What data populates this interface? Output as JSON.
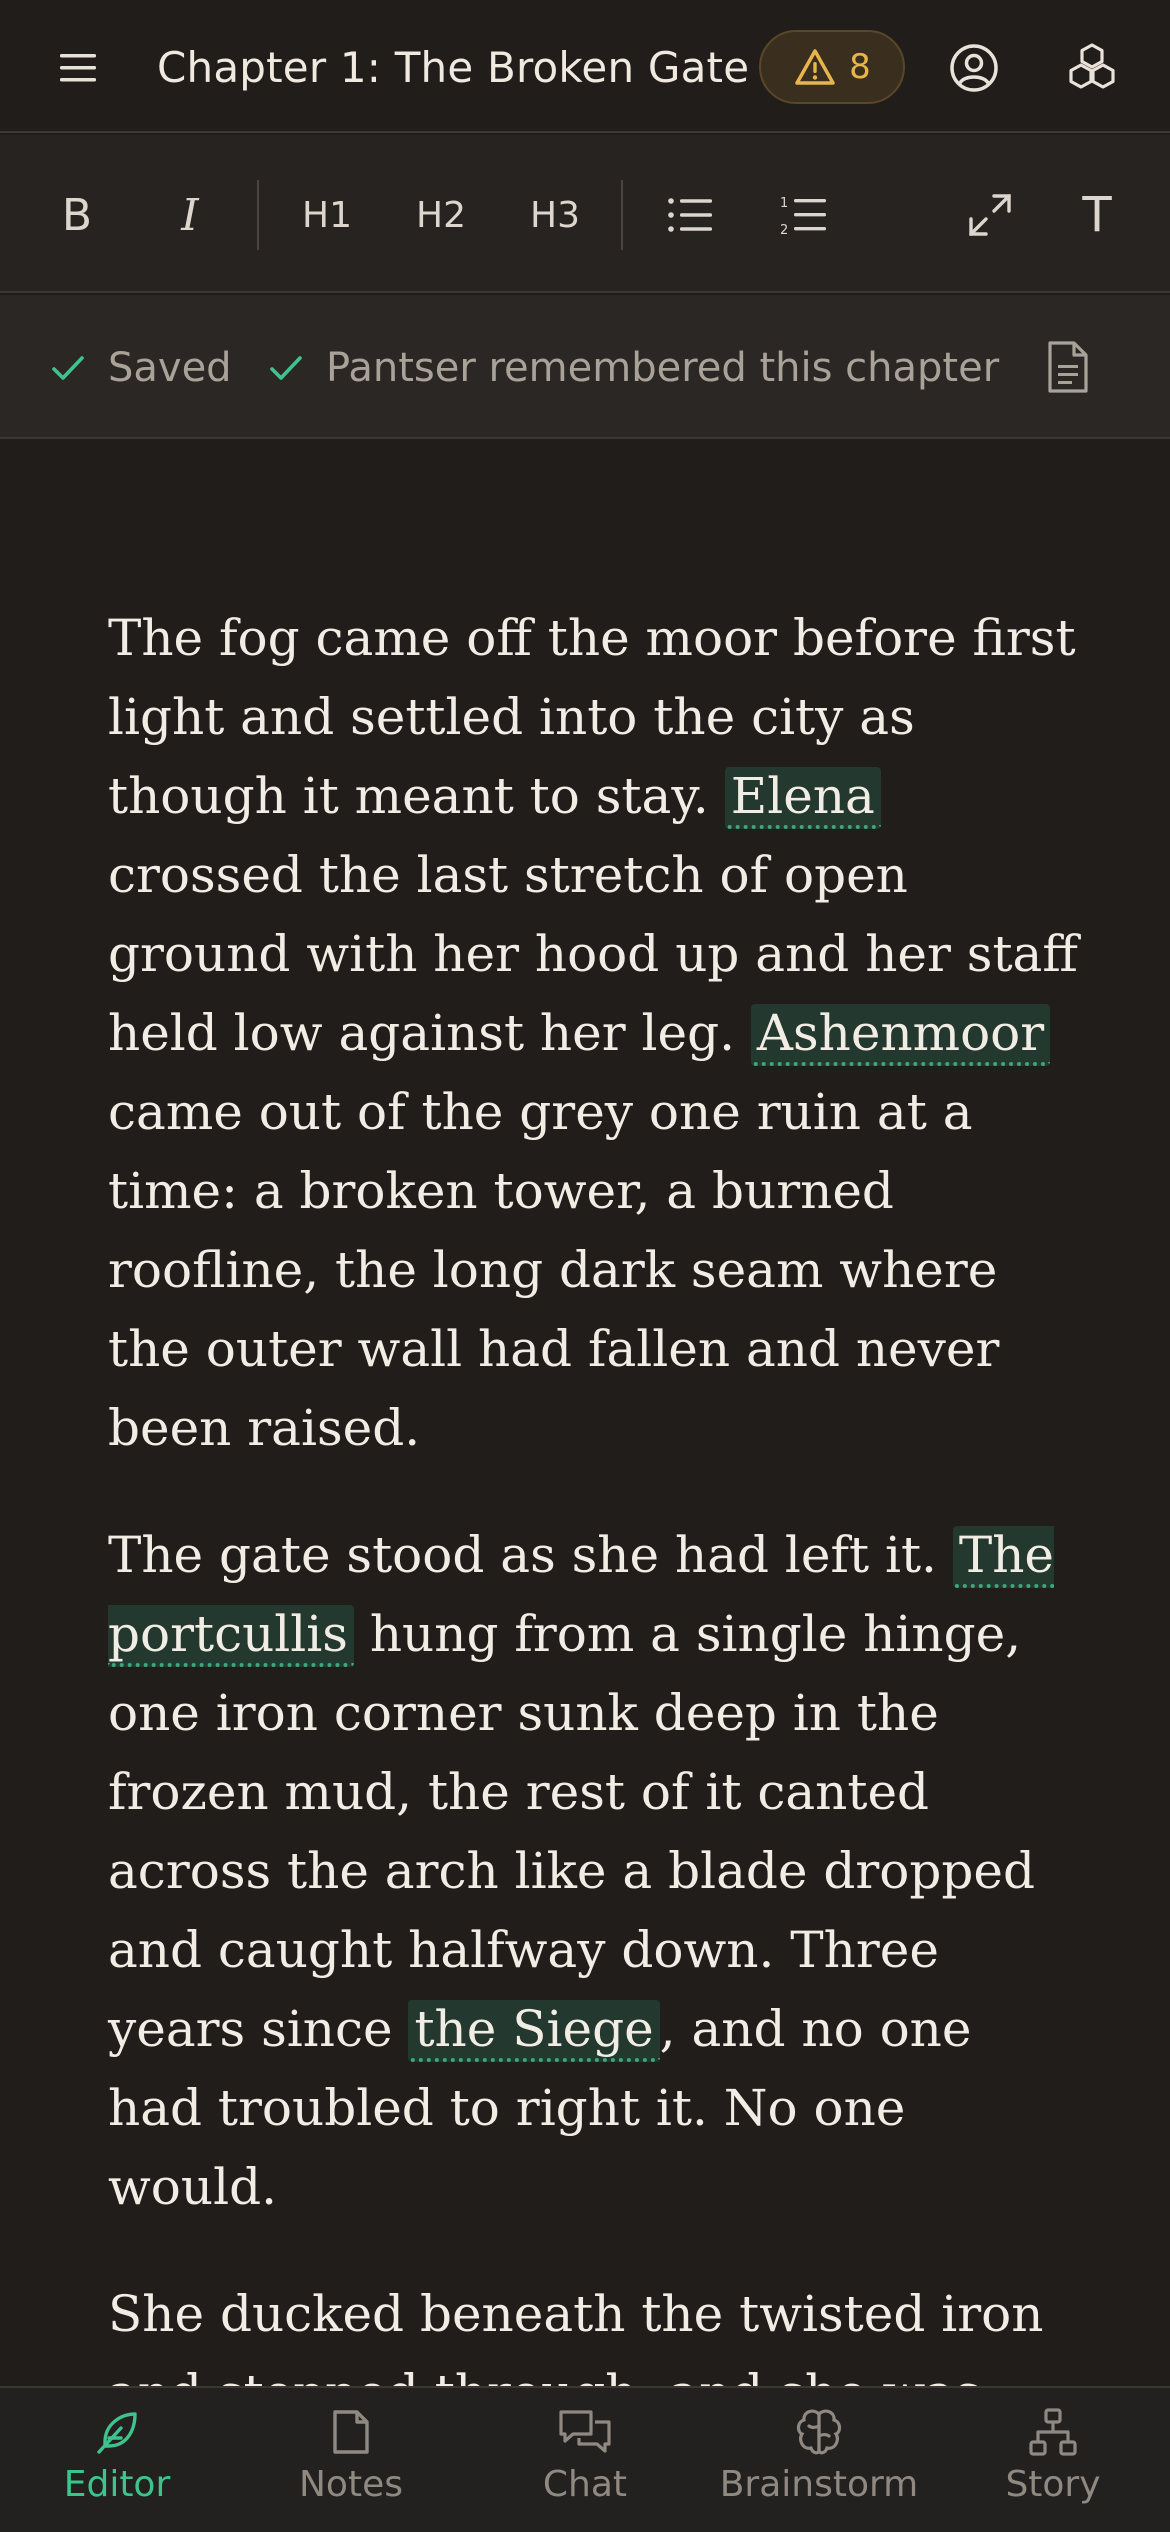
{
  "header": {
    "chapter_title": "Chapter 1: The Broken Gate",
    "warning_count": "8"
  },
  "toolbar": {
    "bold": "B",
    "italic": "I",
    "h1": "H1",
    "h2": "H2",
    "h3": "H3",
    "text_style": "T"
  },
  "status": {
    "saved_label": "Saved",
    "memory_label": "Pantser remembered this chapter"
  },
  "content": {
    "p1": {
      "t1": "The fog came off the moor before first light and settled into the city as though it meant to stay. ",
      "e1": "Elena",
      "t2": " crossed the last stretch of open ground with her hood up and her staff held low against her leg. ",
      "e2": "Ashenmoor",
      "t3": " came out of the grey one ruin at a time: a broken tower, a burned roofline, the long dark seam where the outer wall had fallen and never been raised."
    },
    "p2": {
      "t1": "The gate stood as she had left it. ",
      "e1": "The portcullis",
      "t2": " hung from a single hinge, one iron corner sunk deep in the frozen mud, the rest of it canted across the arch like a blade dropped and caught halfway down. Three years since ",
      "e2": "the Siege",
      "t3": ", and no one had troubled to right it. No one would."
    },
    "p3": {
      "t1": "She ducked beneath the twisted iron and stepped through, and she was home."
    }
  },
  "nav": {
    "items": [
      {
        "label": "Editor",
        "icon": "feather-icon",
        "active": true
      },
      {
        "label": "Notes",
        "icon": "notes-icon",
        "active": false
      },
      {
        "label": "Chat",
        "icon": "chat-icon",
        "active": false
      },
      {
        "label": "Brainstorm",
        "icon": "brain-icon",
        "active": false
      },
      {
        "label": "Story",
        "icon": "story-map-icon",
        "active": false
      }
    ]
  },
  "colors": {
    "accent": "#3cc48c",
    "warning": "#e7b54a",
    "background": "#201d1b"
  }
}
